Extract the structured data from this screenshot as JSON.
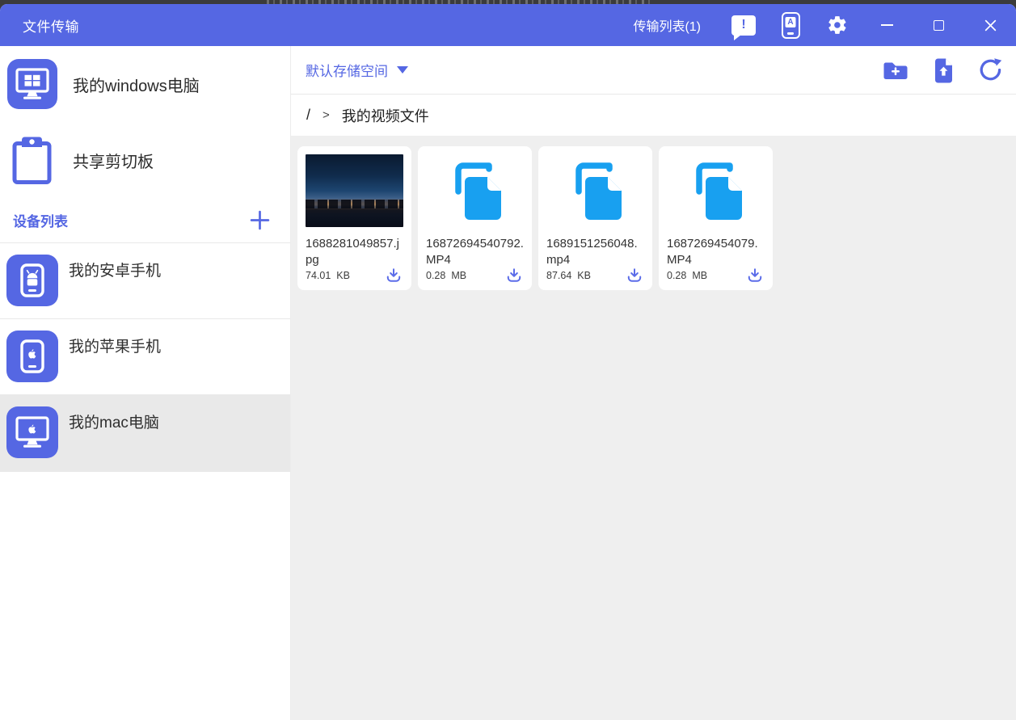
{
  "colors": {
    "accent": "#5567e3",
    "file_icon_blue": "#18a0f0",
    "download_icon": "#5b6ce9",
    "content_bg": "#efefef",
    "selected_bg": "#e9e9e9"
  },
  "titlebar": {
    "title": "文件传输",
    "transfer_list_label": "传输列表(1)",
    "icons": [
      "message-exclaim-icon",
      "phone-a-icon",
      "settings-gear-icon",
      "minimize-icon",
      "maximize-icon",
      "close-icon"
    ]
  },
  "sidebar": {
    "shortcuts": [
      {
        "label": "我的windows电脑",
        "icon": "windows-computer-icon"
      },
      {
        "label": "共享剪切板",
        "icon": "clipboard-icon"
      }
    ],
    "device_list_title": "设备列表",
    "add_device_icon": "plus-icon",
    "devices": [
      {
        "label": "我的安卓手机",
        "icon": "android-phone-icon",
        "selected": false
      },
      {
        "label": "我的苹果手机",
        "icon": "apple-phone-icon",
        "selected": false
      },
      {
        "label": "我的mac电脑",
        "icon": "mac-computer-icon",
        "selected": true
      }
    ]
  },
  "main": {
    "storage_space_label": "默认存储空间",
    "actions": [
      "new-folder-icon",
      "upload-file-icon",
      "refresh-icon"
    ],
    "breadcrumb": {
      "root": "/",
      "separator": ">",
      "current": "我的视频文件"
    },
    "files": [
      {
        "name": "1688281049857.jpg",
        "size": "74.01",
        "unit": "KB",
        "kind": "image"
      },
      {
        "name": "16872694540792.MP4",
        "size": "0.28",
        "unit": "MB",
        "kind": "video"
      },
      {
        "name": "1689151256048.mp4",
        "size": "87.64",
        "unit": "KB",
        "kind": "video"
      },
      {
        "name": "1687269454079.MP4",
        "size": "0.28",
        "unit": "MB",
        "kind": "video"
      }
    ]
  }
}
